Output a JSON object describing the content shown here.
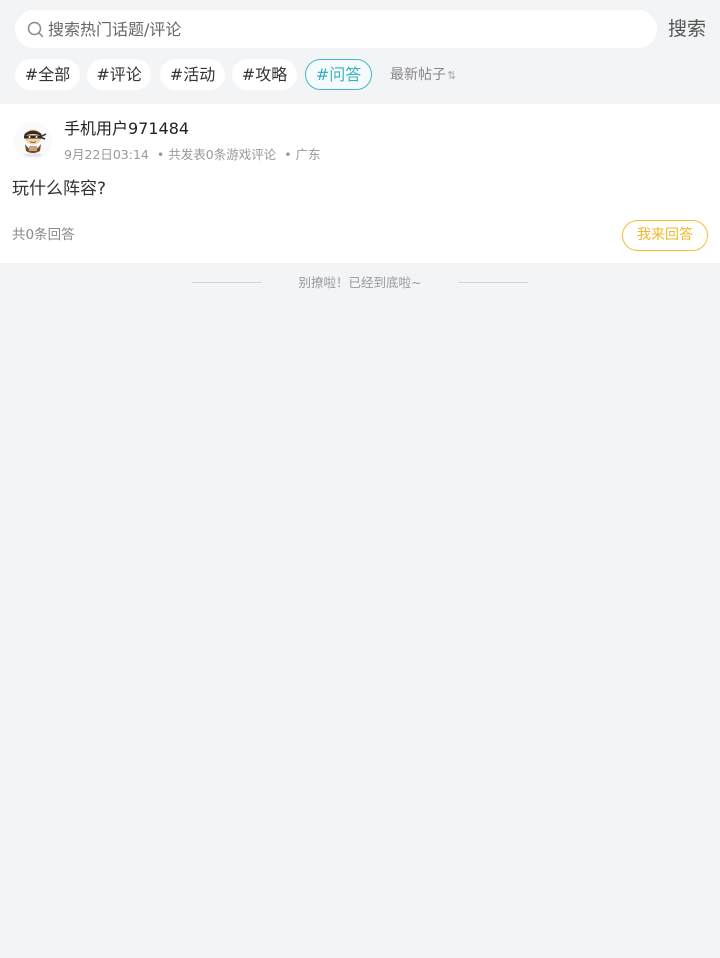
{
  "search": {
    "placeholder": "搜索热门话题/评论",
    "button_label": "搜索"
  },
  "tags": [
    {
      "label": "#全部",
      "active": false
    },
    {
      "label": "#评论",
      "active": false
    },
    {
      "label": "#活动",
      "active": false
    },
    {
      "label": "#攻略",
      "active": false
    },
    {
      "label": "#问答",
      "active": true
    }
  ],
  "sort": {
    "label": "最新帖子",
    "icon": "sort-arrows-icon"
  },
  "post": {
    "username": "手机用户971484",
    "time": "9月22日03:14",
    "comment_stats": "共发表0条游戏评论",
    "location": "广东",
    "separator": "•",
    "title": "玩什么阵容?",
    "answer_count": "共0条回答",
    "answer_button": "我来回答"
  },
  "footer": {
    "end_text": "别撩啦！已经到底啦~"
  },
  "colors": {
    "accent": "#3ab0c2",
    "answer_button": "#f0b72a",
    "page_background": "#f3f4f6"
  }
}
